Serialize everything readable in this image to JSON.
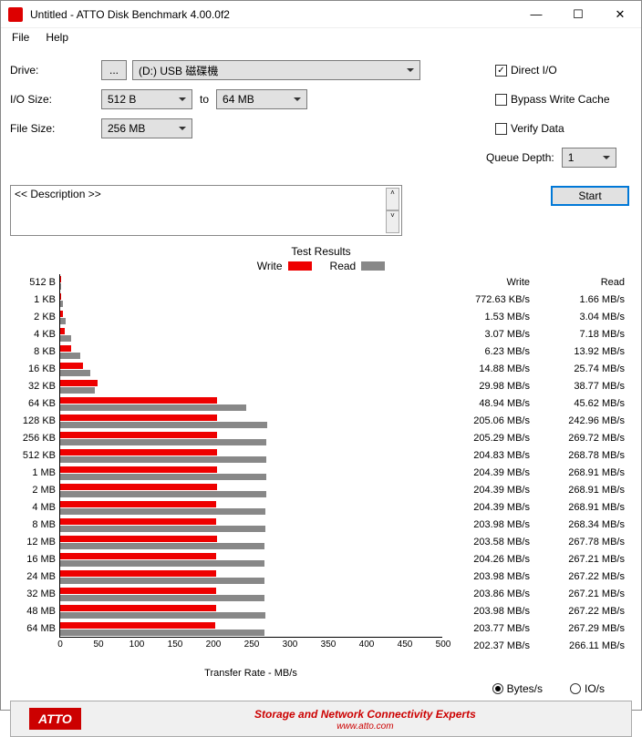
{
  "window": {
    "title": "Untitled - ATTO Disk Benchmark 4.00.0f2",
    "min": "—",
    "max": "☐",
    "close": "✕"
  },
  "menu": {
    "file": "File",
    "help": "Help"
  },
  "labels": {
    "drive": "Drive:",
    "iosize": "I/O Size:",
    "filesize": "File Size:",
    "to": "to",
    "queueDepth": "Queue Depth:",
    "start": "Start",
    "description": "<< Description >>",
    "directIO": "Direct I/O",
    "bypass": "Bypass Write Cache",
    "verify": "Verify Data",
    "drivebrowse": "...",
    "testResults": "Test Results",
    "writeLegend": "Write",
    "readLegend": "Read",
    "writeCol": "Write",
    "readCol": "Read",
    "xlabel": "Transfer Rate - MB/s",
    "bytesPerS": "Bytes/s",
    "ioPerS": "IO/s",
    "footerLogo": "ATTO",
    "footerText": "Storage and Network Connectivity Experts",
    "footerUrl": "www.atto.com"
  },
  "values": {
    "drive": "(D:) USB 磁碟機",
    "ioFrom": "512 B",
    "ioTo": "64 MB",
    "fileSize": "256 MB",
    "queueDepth": "1",
    "directIO_checked": "✓"
  },
  "chart_data": {
    "type": "bar",
    "xlabel": "Transfer Rate - MB/s",
    "xlim": [
      0,
      500
    ],
    "xticks": [
      0,
      50,
      100,
      150,
      200,
      250,
      300,
      350,
      400,
      450,
      500
    ],
    "categories": [
      "512 B",
      "1 KB",
      "2 KB",
      "4 KB",
      "8 KB",
      "16 KB",
      "32 KB",
      "64 KB",
      "128 KB",
      "256 KB",
      "512 KB",
      "1 MB",
      "2 MB",
      "4 MB",
      "8 MB",
      "12 MB",
      "16 MB",
      "24 MB",
      "32 MB",
      "48 MB",
      "64 MB"
    ],
    "series": [
      {
        "name": "Write",
        "unit": "MB/s",
        "values": [
          0.77263,
          1.53,
          3.07,
          6.23,
          14.88,
          29.98,
          48.94,
          205.06,
          205.29,
          204.83,
          204.39,
          204.39,
          204.39,
          203.98,
          203.58,
          204.26,
          203.98,
          203.86,
          203.98,
          203.77,
          202.37
        ],
        "display": [
          "772.63 KB/s",
          "1.53 MB/s",
          "3.07 MB/s",
          "6.23 MB/s",
          "14.88 MB/s",
          "29.98 MB/s",
          "48.94 MB/s",
          "205.06 MB/s",
          "205.29 MB/s",
          "204.83 MB/s",
          "204.39 MB/s",
          "204.39 MB/s",
          "204.39 MB/s",
          "203.98 MB/s",
          "203.58 MB/s",
          "204.26 MB/s",
          "203.98 MB/s",
          "203.86 MB/s",
          "203.98 MB/s",
          "203.77 MB/s",
          "202.37 MB/s"
        ]
      },
      {
        "name": "Read",
        "unit": "MB/s",
        "values": [
          1.66,
          3.04,
          7.18,
          13.92,
          25.74,
          38.77,
          45.62,
          242.96,
          269.72,
          268.78,
          268.91,
          268.91,
          268.91,
          268.34,
          267.78,
          267.21,
          267.22,
          267.21,
          267.22,
          267.29,
          266.11
        ],
        "display": [
          "1.66 MB/s",
          "3.04 MB/s",
          "7.18 MB/s",
          "13.92 MB/s",
          "25.74 MB/s",
          "38.77 MB/s",
          "45.62 MB/s",
          "242.96 MB/s",
          "269.72 MB/s",
          "268.78 MB/s",
          "268.91 MB/s",
          "268.91 MB/s",
          "268.91 MB/s",
          "268.34 MB/s",
          "267.78 MB/s",
          "267.21 MB/s",
          "267.22 MB/s",
          "267.21 MB/s",
          "267.22 MB/s",
          "267.29 MB/s",
          "266.11 MB/s"
        ]
      }
    ]
  }
}
